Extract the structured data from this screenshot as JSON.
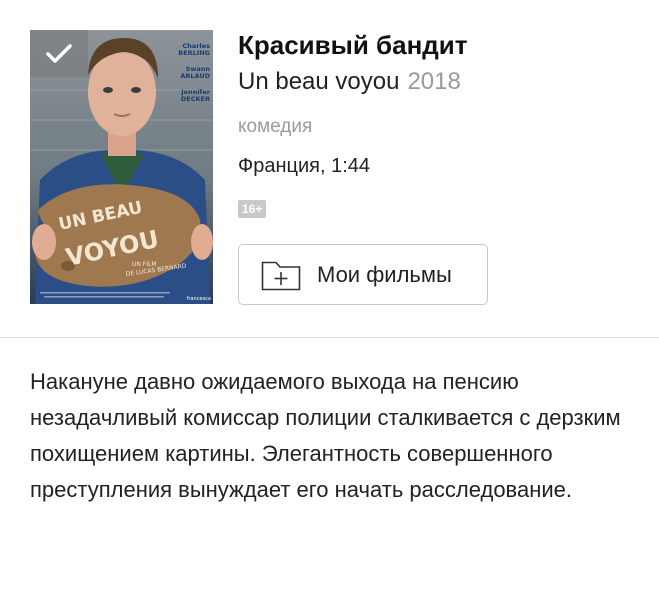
{
  "movie": {
    "title": "Красивый бандит",
    "original_title": "Un beau voyou",
    "year": "2018",
    "genre": "комедия",
    "country_duration": "Франция, 1:44",
    "age_rating": "16+",
    "description": "Накануне давно ожидаемого выхода на пенсию незадачливый комиссар полиции сталкивается с дерзким похищением картины. Элегантность совершенного преступления вынуждает его начать расследование."
  },
  "poster": {
    "title_line1": "UN BEAU",
    "title_line2": "VOYOU",
    "credit_line1": "UN FILM",
    "credit_line2": "DE LUCAS BERNARD",
    "cast": [
      "Charles",
      "BERLING",
      "Swann",
      "ARLAUD",
      "Jennifer",
      "DECKER"
    ],
    "studio": "francesca",
    "selected_icon": "checkmark-icon"
  },
  "actions": {
    "my_films_label": "Мои фильмы",
    "my_films_icon": "folder-add-icon"
  },
  "colors": {
    "age_badge_bg": "#c9c9c9",
    "year_color": "#9a9a9a",
    "genre_color": "#9b9b9b",
    "poster_title_color": "#f3e7d2"
  }
}
